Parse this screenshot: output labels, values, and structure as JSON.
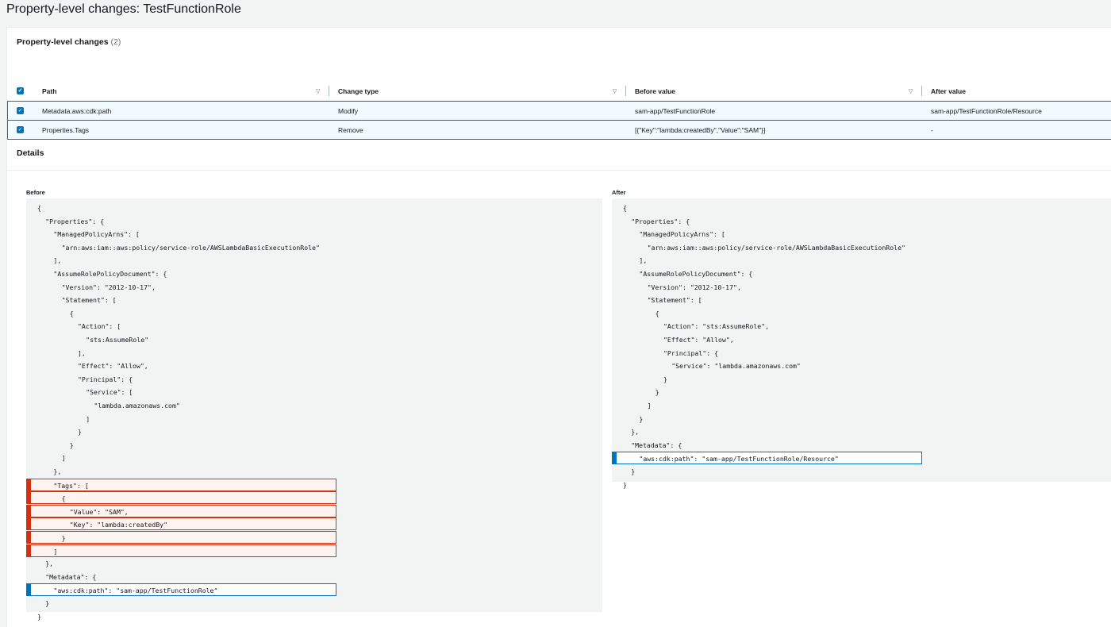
{
  "page": {
    "title": "Property-level changes: TestFunctionRole"
  },
  "changes": {
    "title": "Property-level changes",
    "count": "(2)",
    "columns": [
      "Path",
      "Change type",
      "Before value",
      "After value"
    ],
    "rows": [
      {
        "path": "Metadata.aws:cdk:path",
        "change_type": "Modify",
        "before": "sam-app/TestFunctionRole",
        "after": "sam-app/TestFunctionRole/Resource"
      },
      {
        "path": "Properties.Tags",
        "change_type": "Remove",
        "before": "[{\"Key\":\"lambda:createdBy\",\"Value\":\"SAM\"}]",
        "after": "-"
      }
    ]
  },
  "details": {
    "title": "Details",
    "before": {
      "label": "Before",
      "lines": [
        {
          "text": "{",
          "indent": 0
        },
        {
          "text": "\"Properties\": {",
          "indent": 1
        },
        {
          "text": "\"ManagedPolicyArns\": [",
          "indent": 2
        },
        {
          "text": "\"arn:aws:iam::aws:policy/service-role/AWSLambdaBasicExecutionRole\"",
          "indent": 3
        },
        {
          "text": "],",
          "indent": 2
        },
        {
          "text": "\"AssumeRolePolicyDocument\": {",
          "indent": 2
        },
        {
          "text": "\"Version\": \"2012-10-17\",",
          "indent": 3
        },
        {
          "text": "\"Statement\": [",
          "indent": 3
        },
        {
          "text": "{",
          "indent": 4
        },
        {
          "text": "\"Action\": [",
          "indent": 5
        },
        {
          "text": "\"sts:AssumeRole\"",
          "indent": 6
        },
        {
          "text": "],",
          "indent": 5
        },
        {
          "text": "\"Effect\": \"Allow\",",
          "indent": 5
        },
        {
          "text": "\"Principal\": {",
          "indent": 5
        },
        {
          "text": "\"Service\": [",
          "indent": 6
        },
        {
          "text": "\"lambda.amazonaws.com\"",
          "indent": 7
        },
        {
          "text": "]",
          "indent": 6
        },
        {
          "text": "}",
          "indent": 5
        },
        {
          "text": "}",
          "indent": 4
        },
        {
          "text": "]",
          "indent": 3
        },
        {
          "text": "},",
          "indent": 2
        },
        {
          "text": "\"Tags\": [",
          "indent": 2,
          "status": "removed"
        },
        {
          "text": "{",
          "indent": 3,
          "status": "removed"
        },
        {
          "text": "\"Value\": \"SAM\",",
          "indent": 4,
          "status": "removed"
        },
        {
          "text": "\"Key\": \"lambda:createdBy\"",
          "indent": 4,
          "status": "removed"
        },
        {
          "text": "}",
          "indent": 3,
          "status": "removed"
        },
        {
          "text": "]",
          "indent": 2,
          "status": "removed"
        },
        {
          "text": "},",
          "indent": 1
        },
        {
          "text": "\"Metadata\": {",
          "indent": 1
        },
        {
          "text": "\"aws:cdk:path\": \"sam-app/TestFunctionRole\"",
          "indent": 2,
          "status": "changed"
        },
        {
          "text": "}",
          "indent": 1
        },
        {
          "text": "}",
          "indent": 0
        }
      ]
    },
    "after": {
      "label": "After",
      "lines": [
        {
          "text": "{",
          "indent": 0
        },
        {
          "text": "\"Properties\": {",
          "indent": 1
        },
        {
          "text": "\"ManagedPolicyArns\": [",
          "indent": 2
        },
        {
          "text": "\"arn:aws:iam::aws:policy/service-role/AWSLambdaBasicExecutionRole\"",
          "indent": 3
        },
        {
          "text": "],",
          "indent": 2
        },
        {
          "text": "\"AssumeRolePolicyDocument\": {",
          "indent": 2
        },
        {
          "text": "\"Version\": \"2012-10-17\",",
          "indent": 3
        },
        {
          "text": "\"Statement\": [",
          "indent": 3
        },
        {
          "text": "{",
          "indent": 4
        },
        {
          "text": "\"Action\": \"sts:AssumeRole\",",
          "indent": 5
        },
        {
          "text": "\"Effect\": \"Allow\",",
          "indent": 5
        },
        {
          "text": "\"Principal\": {",
          "indent": 5
        },
        {
          "text": "\"Service\": \"lambda.amazonaws.com\"",
          "indent": 6
        },
        {
          "text": "}",
          "indent": 5
        },
        {
          "text": "}",
          "indent": 4
        },
        {
          "text": "]",
          "indent": 3
        },
        {
          "text": "}",
          "indent": 2
        },
        {
          "text": "},",
          "indent": 1
        },
        {
          "text": "\"Metadata\": {",
          "indent": 1
        },
        {
          "text": "\"aws:cdk:path\": \"sam-app/TestFunctionRole/Resource\"",
          "indent": 2,
          "status": "changed"
        },
        {
          "text": "}",
          "indent": 1
        },
        {
          "text": "}",
          "indent": 0
        }
      ]
    }
  },
  "colors": {
    "removed": "#d13212",
    "changed": "#0073bb",
    "checkbox": "#0073bb"
  }
}
